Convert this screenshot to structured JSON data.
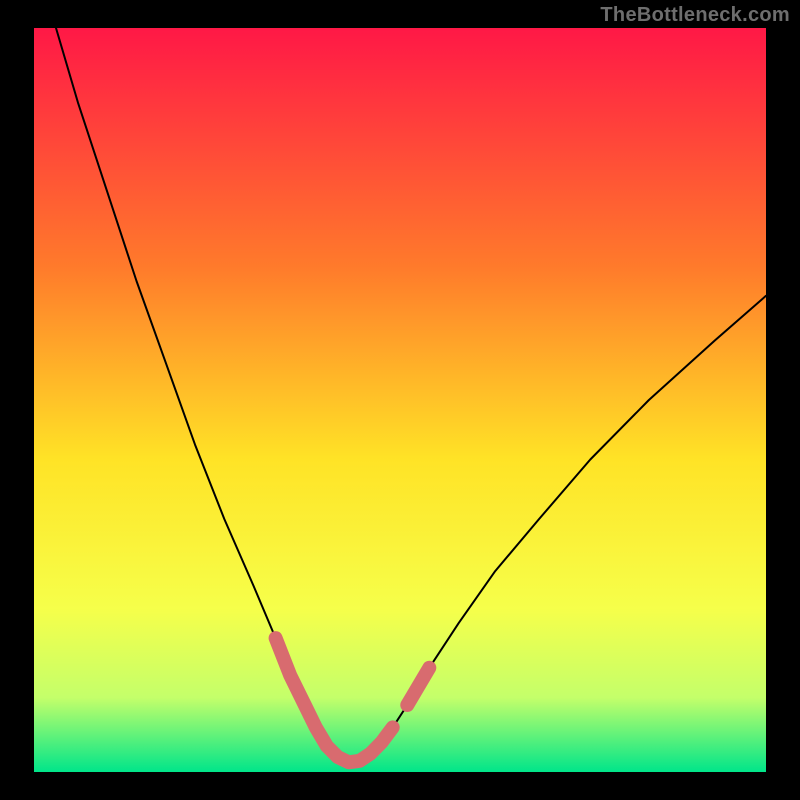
{
  "watermark": "TheBottleneck.com",
  "colors": {
    "frame": "#000000",
    "gradient_top": "#ff1846",
    "gradient_mid1": "#ff7a2b",
    "gradient_mid2": "#ffe326",
    "gradient_mid3": "#f6ff4a",
    "gradient_low": "#c4ff6a",
    "gradient_bottom": "#00e58a",
    "curve_black": "#000000",
    "curve_highlight": "#d86b6f"
  },
  "chart_data": {
    "type": "line",
    "title": "",
    "xlabel": "",
    "ylabel": "",
    "xlim": [
      0,
      100
    ],
    "ylim": [
      0,
      100
    ],
    "series": [
      {
        "name": "bottleneck-curve",
        "x": [
          3,
          6,
          10,
          14,
          18,
          22,
          26,
          30,
          33,
          35,
          37,
          38.5,
          40,
          41.5,
          43,
          44.5,
          46,
          47.5,
          49,
          51,
          54,
          58,
          63,
          69,
          76,
          84,
          93,
          100
        ],
        "y": [
          100,
          90,
          78,
          66,
          55,
          44,
          34,
          25,
          18,
          13,
          9,
          6,
          3.5,
          2,
          1.3,
          1.5,
          2.5,
          4,
          6,
          9,
          14,
          20,
          27,
          34,
          42,
          50,
          58,
          64
        ]
      }
    ],
    "highlight_segments": [
      {
        "name": "left-highlight",
        "x": [
          33,
          35,
          37,
          38.5,
          40,
          41.5,
          43,
          44.5,
          46,
          47.5,
          49
        ],
        "y": [
          18,
          13,
          9,
          6,
          3.5,
          2,
          1.3,
          1.5,
          2.5,
          4,
          6
        ]
      },
      {
        "name": "right-highlight",
        "x": [
          51,
          54
        ],
        "y": [
          9,
          14
        ]
      }
    ]
  }
}
